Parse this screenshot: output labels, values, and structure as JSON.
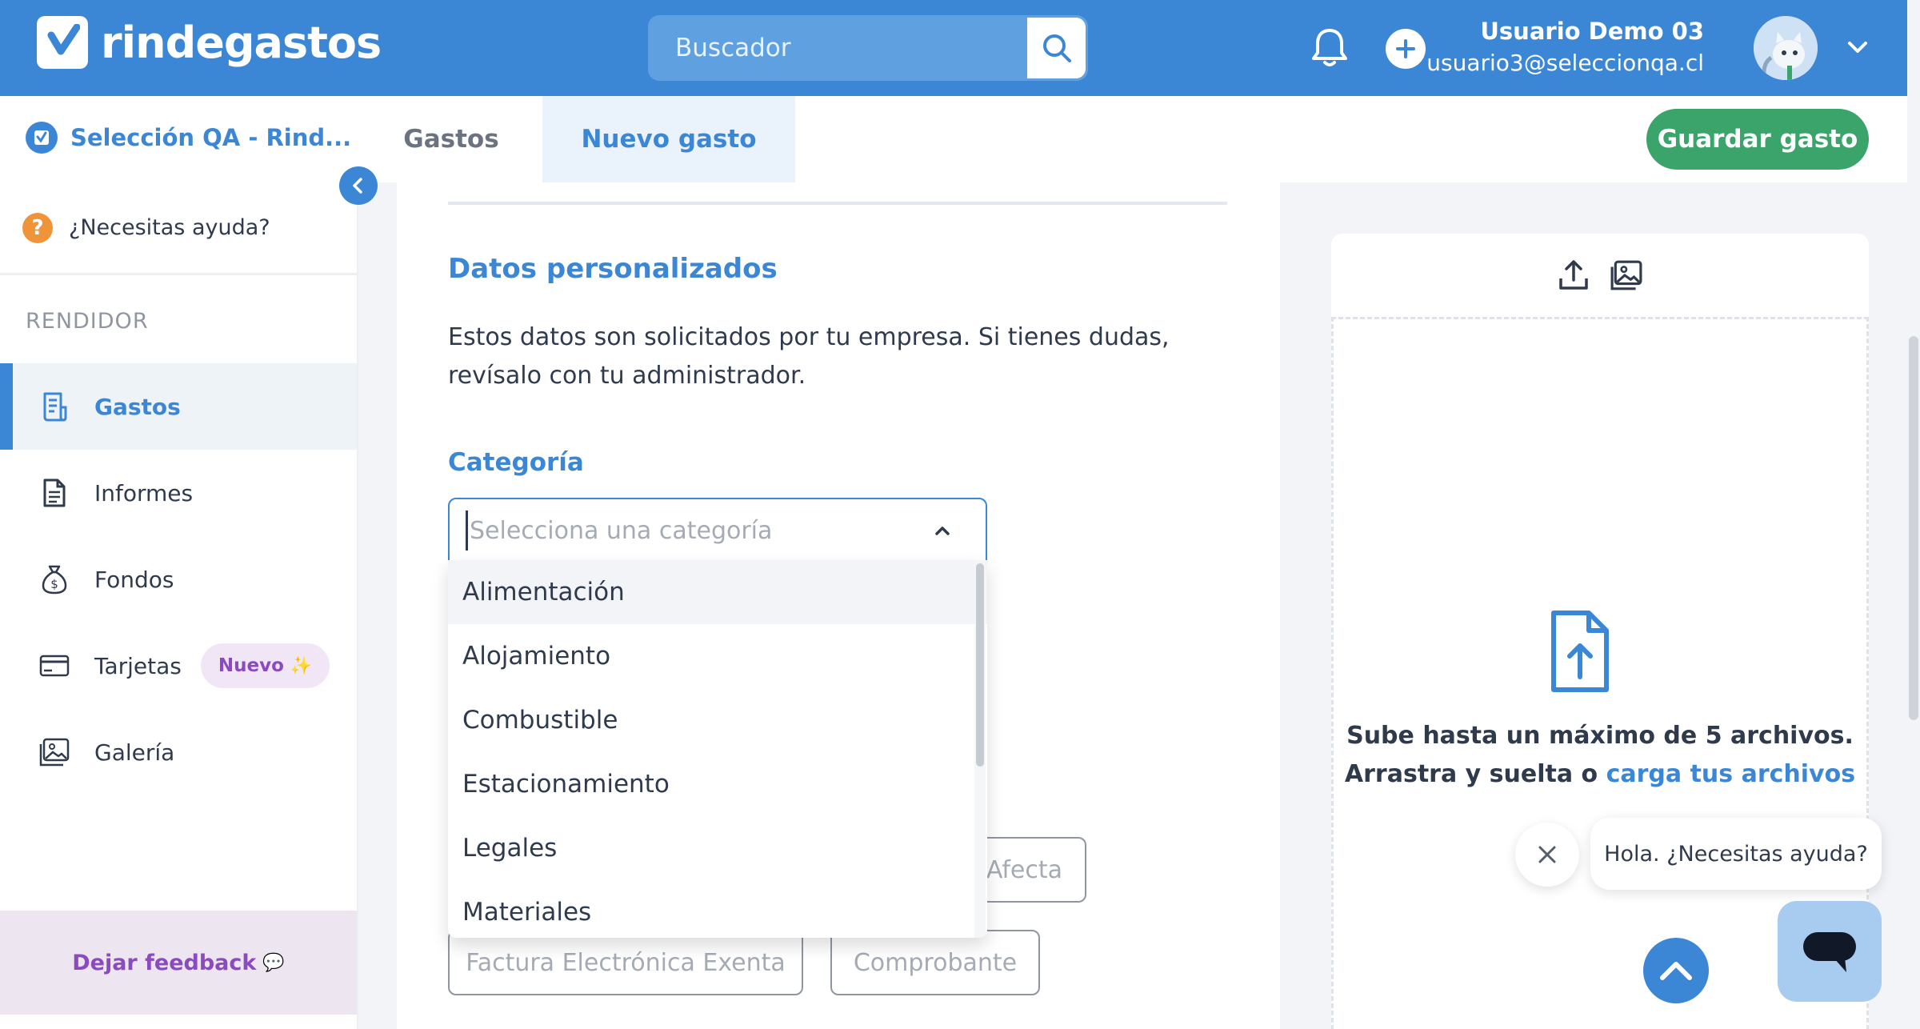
{
  "brand": {
    "name": "rindegastos"
  },
  "search": {
    "placeholder": "Buscador"
  },
  "user": {
    "name": "Usuario Demo 03",
    "email": "usuario3@seleccionqa.cl"
  },
  "company": {
    "name": "Selección QA - Rind..."
  },
  "tabs": [
    {
      "label": "Gastos",
      "active": false
    },
    {
      "label": "Nuevo gasto",
      "active": true
    }
  ],
  "actions": {
    "save_label": "Guardar gasto"
  },
  "sidebar": {
    "help_label": "¿Necesitas ayuda?",
    "section_label": "RENDIDOR",
    "items": [
      {
        "label": "Gastos",
        "icon": "receipt-icon",
        "active": true
      },
      {
        "label": "Informes",
        "icon": "document-icon",
        "active": false
      },
      {
        "label": "Fondos",
        "icon": "money-bag-icon",
        "active": false
      },
      {
        "label": "Tarjetas",
        "icon": "card-icon",
        "active": false,
        "badge": "Nuevo",
        "badge_glyph": "✨"
      },
      {
        "label": "Galería",
        "icon": "gallery-icon",
        "active": false
      }
    ],
    "feedback_label": "Dejar feedback",
    "feedback_glyph": "💬"
  },
  "form": {
    "section_title": "Datos personalizados",
    "section_desc": "Estos datos son solicitados por tu empresa. Si tienes dudas, revísalo con tu administrador.",
    "category_label": "Categoría",
    "category_placeholder": "Selecciona una categoría",
    "category_value": "",
    "category_options": [
      "Alimentación",
      "Alojamiento",
      "Combustible",
      "Estacionamiento",
      "Legales",
      "Materiales"
    ],
    "category_highlighted": "Alimentación",
    "document_types_visible": [
      "Afecta",
      "Factura Electrónica Exenta",
      "Comprobante"
    ]
  },
  "upload": {
    "line1": "Sube hasta un máximo de 5 archivos.",
    "line2_prefix": "Arrastra y suelta o ",
    "line2_link": "carga tus archivos"
  },
  "chat": {
    "greeting": "Hola. ¿Necesitas ayuda?"
  },
  "colors": {
    "primary": "#3b87d6",
    "save": "#3aa46a",
    "help": "#f0943a",
    "feedback": "#8a4bbf"
  }
}
